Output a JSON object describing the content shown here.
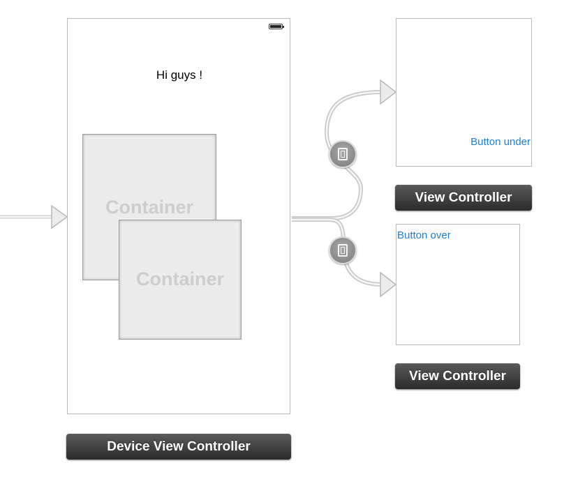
{
  "main_scene": {
    "greeting": "Hi guys !",
    "containers": [
      {
        "label": "Container"
      },
      {
        "label": "Container"
      }
    ],
    "dock_title": "Device View Controller"
  },
  "child_scenes": [
    {
      "button_label": "Button under",
      "dock_title": "View Controller"
    },
    {
      "button_label": "Button over",
      "dock_title": "View Controller"
    }
  ],
  "icons": {
    "segue": "embed-segue-icon",
    "battery": "battery-icon",
    "entry_arrow": "initial-scene-arrow"
  },
  "colors": {
    "link_blue": "#1f7fd2",
    "dock_dark": "#2b2b2b",
    "container_gray": "#ececec",
    "connector_gray": "#c8c8c8"
  }
}
